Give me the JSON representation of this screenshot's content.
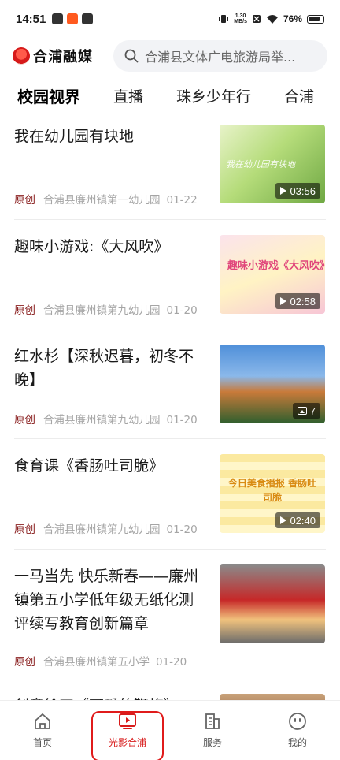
{
  "status_bar": {
    "time": "14:51",
    "speed_value": "1.30",
    "speed_unit": "MB/s",
    "battery": "76%",
    "left_icons": [
      {
        "name": "app-icon-1",
        "color": "#333333"
      },
      {
        "name": "app-icon-2",
        "color": "#ff5a1f"
      },
      {
        "name": "app-icon-3",
        "color": "#333333"
      }
    ]
  },
  "header": {
    "logo_text": "合浦融媒",
    "search_placeholder": "合浦县文体广电旅游局举..."
  },
  "tabs": [
    {
      "label": "校园视界",
      "active": true
    },
    {
      "label": "直播",
      "active": false
    },
    {
      "label": "珠乡少年行",
      "active": false
    },
    {
      "label": "合浦",
      "active": false
    }
  ],
  "feed": [
    {
      "title": "我在幼儿园有块地",
      "tag": "原创",
      "source": "合浦县廉州镇第一幼儿园",
      "date": "01-22",
      "media": "video",
      "duration": "03:56",
      "thumb_colors": [
        "#cfe9a2",
        "#7fb84e",
        "#e8f3c9"
      ],
      "thumb_caption": "我在幼儿园有块地"
    },
    {
      "title": "趣味小游戏:《大风吹》",
      "tag": "原创",
      "source": "合浦县廉州镇第九幼儿园",
      "date": "01-20",
      "media": "video",
      "duration": "02:58",
      "thumb_colors": [
        "#fbe3ec",
        "#f6d36b",
        "#f7a8c2"
      ],
      "thumb_caption": "趣味小游戏《大风吹》"
    },
    {
      "title": "红水杉【深秋迟暮，初冬不晚】",
      "tag": "原创",
      "source": "合浦县廉州镇第九幼儿园",
      "date": "01-20",
      "media": "image",
      "count": "7",
      "thumb_colors": [
        "#4f8fd9",
        "#c97a3a",
        "#2f5f2e"
      ]
    },
    {
      "title": "食育课《香肠吐司脆》",
      "tag": "原创",
      "source": "合浦县廉州镇第九幼儿园",
      "date": "01-20",
      "media": "video",
      "duration": "02:40",
      "thumb_colors": [
        "#fff6c9",
        "#f3c24a",
        "#ffffff"
      ],
      "thumb_caption": "今日美食播报 香肠吐司脆"
    },
    {
      "title": "一马当先 快乐新春——廉州镇第五小学低年级无纸化测评续写教育创新篇章",
      "tag": "原创",
      "source": "合浦县廉州镇第五小学",
      "date": "01-20",
      "media": "image",
      "thumb_colors": [
        "#c62828",
        "#f1c27d",
        "#6b6b6b"
      ]
    },
    {
      "title": "创意绘画《可爱的鞭炮》",
      "partial": true
    }
  ],
  "bottom_nav": [
    {
      "label": "首页",
      "icon": "home-icon",
      "active": false
    },
    {
      "label": "光影合浦",
      "icon": "tv-play-icon",
      "active": true
    },
    {
      "label": "服务",
      "icon": "building-icon",
      "active": false
    },
    {
      "label": "我的",
      "icon": "face-icon",
      "active": false
    }
  ],
  "colors": {
    "accent": "#d81b1b",
    "tag": "#8b2222",
    "meta": "#a5a5a5"
  }
}
